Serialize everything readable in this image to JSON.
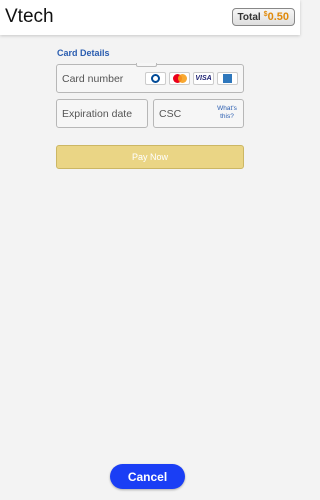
{
  "header": {
    "app_title": "Vtech",
    "total_label": "Total",
    "total_currency": "$",
    "total_amount": "0.50"
  },
  "form": {
    "section_title": "Card Details",
    "card_number_placeholder": "Card number",
    "expiration_placeholder": "Expiration date",
    "csc_placeholder": "CSC",
    "whats_this": "What's this?",
    "card_logos": [
      "diners-icon",
      "mastercard-icon",
      "visa-icon",
      "amex-icon"
    ],
    "visa_text": "VISA"
  },
  "buttons": {
    "pay_label": "Pay Now",
    "cancel_label": "Cancel"
  },
  "colors": {
    "accent_blue": "#1a3ef5",
    "pay_disabled": "#ead585",
    "total_amount": "#e08a0b",
    "section_title": "#2a5db0"
  }
}
